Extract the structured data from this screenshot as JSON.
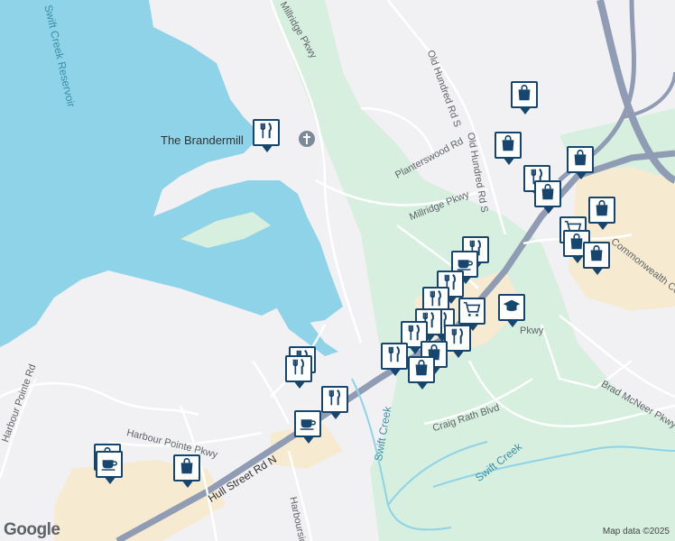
{
  "map": {
    "labels": {
      "reservoir": "Swift Creek Reservoir",
      "brandermill": "The Brandermill",
      "milridge_north": "Millridge Pkwy",
      "old_hundred_1": "Old Hundred Rd S",
      "old_hundred_2": "Old Hundred Rd S",
      "planterswood": "Planterswood Rd",
      "milridge_mid": "Millridge Pkwy",
      "commonwealth": "Commonwealth Ce",
      "pkwy_short": "Pkwy",
      "brad_mcneer": "Brad McNeer Pkwy",
      "harbour_pointe_rd": "Harbour Pointe Rd",
      "harbour_pointe_pkwy": "Harbour Pointe Pkwy",
      "swift_creek_1": "Swift Creek",
      "craig_rath": "Craig Rath Blvd",
      "swift_creek_2": "Swift Creek",
      "hull_street": "Hull Street Rd N",
      "harbourside": "Harboursid"
    },
    "logo": "Google",
    "attribution": "Map data ©2025"
  },
  "markers": [
    {
      "icon": "shopping-bag-icon"
    },
    {
      "icon": "shopping-bag-icon"
    },
    {
      "icon": "shopping-bag-icon"
    },
    {
      "icon": "restaurant-icon"
    },
    {
      "icon": "shopping-bag-icon"
    },
    {
      "icon": "shopping-bag-icon"
    },
    {
      "icon": "shopping-cart-icon"
    },
    {
      "icon": "shopping-bag-icon"
    },
    {
      "icon": "shopping-bag-icon"
    },
    {
      "icon": "restaurant-icon"
    },
    {
      "icon": "cafe-icon"
    },
    {
      "icon": "restaurant-icon"
    },
    {
      "icon": "restaurant-icon"
    },
    {
      "icon": "shopping-cart-icon"
    },
    {
      "icon": "school-icon"
    },
    {
      "icon": "restaurant-icon"
    },
    {
      "icon": "restaurant-icon"
    },
    {
      "icon": "restaurant-icon"
    },
    {
      "icon": "restaurant-icon"
    },
    {
      "icon": "shopping-bag-icon"
    },
    {
      "icon": "shopping-bag-icon"
    },
    {
      "icon": "restaurant-icon"
    },
    {
      "icon": "restaurant-icon"
    },
    {
      "icon": "restaurant-icon"
    },
    {
      "icon": "restaurant-icon"
    },
    {
      "icon": "cafe-icon"
    },
    {
      "icon": "shopping-bag-icon"
    },
    {
      "icon": "cafe-icon"
    },
    {
      "icon": "shopping-bag-icon"
    },
    {
      "icon": "restaurant-icon"
    }
  ]
}
